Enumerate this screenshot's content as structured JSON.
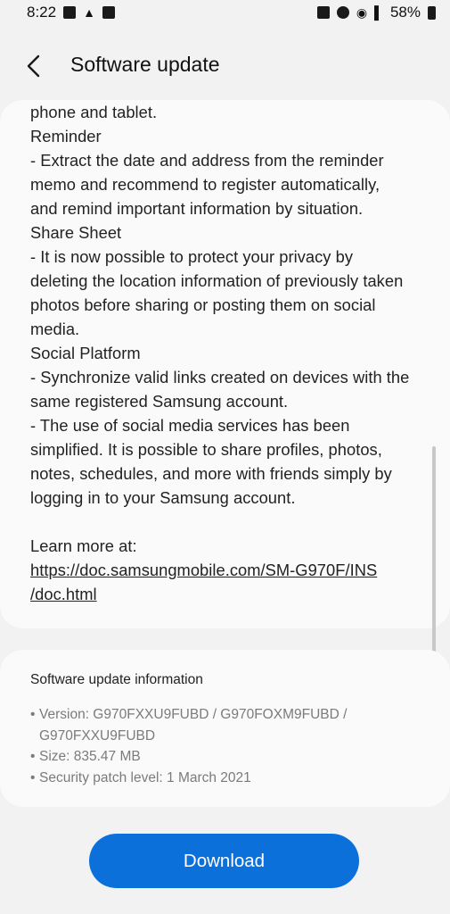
{
  "status_bar": {
    "time": "8:22",
    "battery": "58%"
  },
  "header": {
    "title": "Software update",
    "back_icon": "chevron-left-icon"
  },
  "release_notes": {
    "lines": [
      "phone and tablet.",
      "Reminder",
      " - Extract the date and address from the reminder",
      "memo and recommend to register automatically,",
      "and remind important information by situation.",
      "Share Sheet",
      " - It is now possible to protect your privacy by",
      "deleting the location information of previously taken",
      "photos before sharing or posting them on social",
      "media.",
      "Social Platform",
      " - Synchronize valid links created on devices with the",
      "same registered Samsung account.",
      " - The use of social media services has been",
      "simplified. It is possible to share profiles, photos,",
      "notes, schedules, and more with friends simply by",
      "logging in to your Samsung account."
    ],
    "learn_more": "Learn more at:",
    "link_line1": "https://doc.samsungmobile.com/SM-G970F/INS",
    "link_line2": "/doc.html"
  },
  "update_info": {
    "title": "Software update information",
    "bullet": "•",
    "version_label": "Version: G970FXXU9FUBD / G970FOXM9FUBD /",
    "version_cont": "G970FXXU9FUBD",
    "size": "Size: 835.47 MB",
    "security_patch": "Security patch level: 1 March 2021"
  },
  "actions": {
    "download_label": "Download"
  },
  "colors": {
    "accent": "#0b70d9",
    "background": "#f2f2f2",
    "card": "#fafafa"
  }
}
